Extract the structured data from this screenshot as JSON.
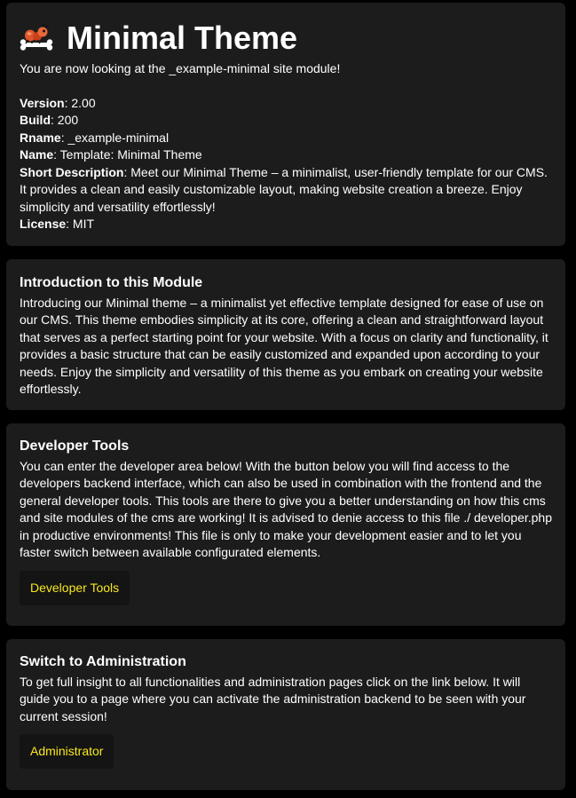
{
  "header": {
    "title": "Minimal Theme",
    "subtitle": "You are now looking at the _example-minimal site module!"
  },
  "meta": {
    "version_label": "Version",
    "version_value": ": 2.00",
    "build_label": "Build",
    "build_value": ": 200",
    "rname_label": "Rname",
    "rname_value": ": _example-minimal",
    "name_label": "Name",
    "name_value": ": Template: Minimal Theme",
    "short_desc_label": "Short Description",
    "short_desc_value": ": Meet our Minimal Theme – a minimalist, user-friendly template for our CMS. It provides a clean and easily customizable layout, making website creation a breeze. Enjoy simplicity and versatility effortlessly!",
    "license_label": "License",
    "license_value": ": MIT"
  },
  "intro": {
    "title": "Introduction to this Module",
    "text": "Introducing our Minimal theme – a minimalist yet effective template designed for ease of use on our CMS. This theme embodies simplicity at its core, offering a clean and straightforward layout that serves as a perfect starting point for your website. With a focus on clarity and functionality, it provides a basic structure that can be easily customized and expanded upon according to your needs. Enjoy the simplicity and versatility of this theme as you embark on creating your website effortlessly."
  },
  "developer": {
    "title": "Developer Tools",
    "text": "You can enter the developer area below! With the button below you will find access to the developers backend interface, which can also be used in combination with the frontend and the general developer tools. This tools are there to give you a better understanding on how this cms and site modules of the cms are working! It is advised to denie access to this file ./ developer.php in productive environments! This file is only to make your development easier and to let you faster switch between available configurated elements.",
    "button_label": "Developer Tools"
  },
  "admin": {
    "title": "Switch to Administration",
    "text": "To get full insight to all functionalities and administration pages click on the link below. It will guide you to a page where you can activate the administration backend to be seen with your current session!",
    "button_label": "Administrator"
  },
  "colors": {
    "page_bg": "#000000",
    "card_bg": "#1c1c1c",
    "button_bg": "#141414",
    "button_text": "#f7e81e",
    "text": "#ffffff"
  },
  "icons": {
    "logo": "ant-with-bone-logo-icon"
  }
}
